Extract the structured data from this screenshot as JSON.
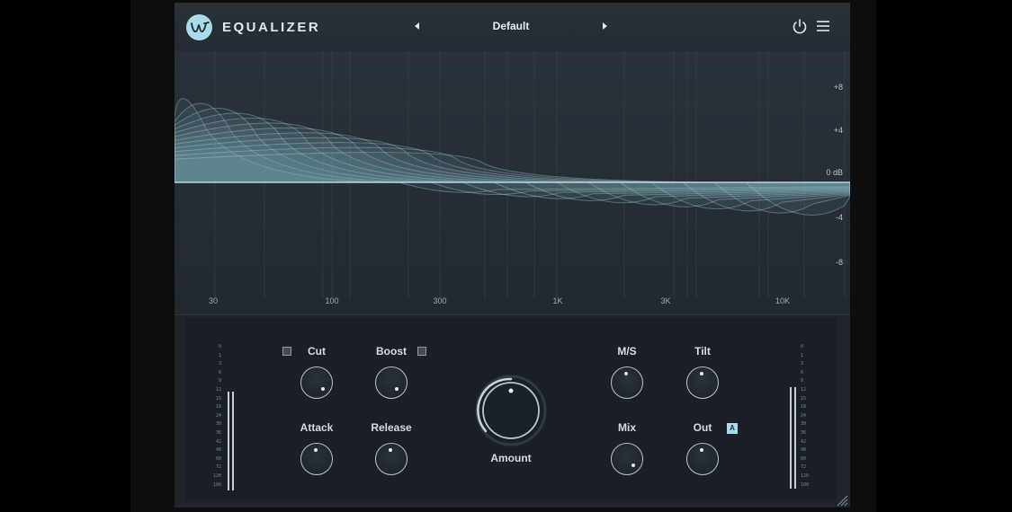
{
  "header": {
    "title": "EQUALIZER",
    "preset": "Default",
    "prev_icon": "triangle-left-icon",
    "next_icon": "triangle-right-icon",
    "power_icon": "power-icon",
    "menu_icon": "hamburger-menu-icon",
    "logo_icon": "w-logo-icon"
  },
  "graph": {
    "db_labels": [
      "+8",
      "+4",
      "0 dB",
      "-4",
      "-8"
    ],
    "freq_labels": [
      "30",
      "100",
      "300",
      "1K",
      "3K",
      "10K"
    ]
  },
  "controls": {
    "cut": {
      "label": "Cut",
      "checked": false
    },
    "boost": {
      "label": "Boost",
      "checked": false
    },
    "attack": {
      "label": "Attack"
    },
    "release": {
      "label": "Release"
    },
    "amount": {
      "label": "Amount"
    },
    "ms": {
      "label": "M/S"
    },
    "tilt": {
      "label": "Tilt"
    },
    "mix": {
      "label": "Mix"
    },
    "out": {
      "label": "Out",
      "auto_badge": "A"
    }
  },
  "meters": {
    "left_scale": [
      "0",
      "1",
      "3",
      "6",
      "9",
      "12",
      "15",
      "18",
      "24",
      "30",
      "36",
      "42",
      "48",
      "60",
      "72",
      "120",
      "100"
    ],
    "right_scale": [
      "0",
      "1",
      "3",
      "6",
      "9",
      "12",
      "15",
      "18",
      "24",
      "30",
      "36",
      "42",
      "48",
      "60",
      "72",
      "120",
      "100"
    ]
  },
  "colors": {
    "accent": "#a9dbe8",
    "panel": "#22292f",
    "background": "#000000"
  }
}
